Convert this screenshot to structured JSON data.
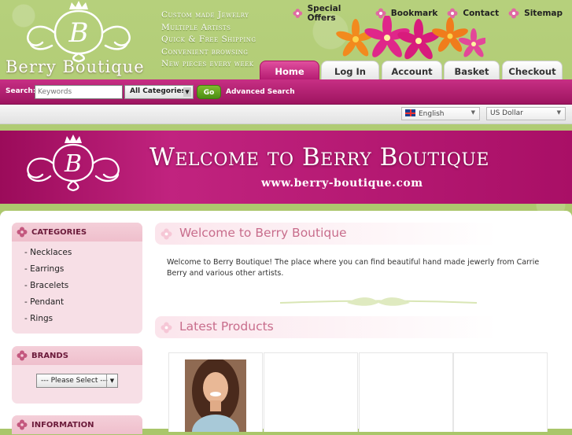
{
  "brand": {
    "name": "Berry Boutique",
    "monogram": "B"
  },
  "taglines": [
    "Custom made Jewelry",
    "Multiple Artists",
    "Quick & Free Shipping",
    "Convenient browsing",
    "New pieces every week"
  ],
  "top_links": [
    {
      "label": "Special Offers",
      "icon": "flower-icon"
    },
    {
      "label": "Bookmark",
      "icon": "flower-icon"
    },
    {
      "label": "Contact",
      "icon": "flower-icon"
    },
    {
      "label": "Sitemap",
      "icon": "flower-icon"
    }
  ],
  "tabs": [
    {
      "label": "Home",
      "active": true
    },
    {
      "label": "Log In",
      "active": false
    },
    {
      "label": "Account",
      "active": false
    },
    {
      "label": "Basket",
      "active": false
    },
    {
      "label": "Checkout",
      "active": false
    }
  ],
  "search": {
    "label": "Search:",
    "placeholder": "Keywords",
    "category_selected": "All Categories",
    "go_label": "Go",
    "advanced_label": "Advanced Search"
  },
  "language": {
    "selected": "English"
  },
  "currency": {
    "selected": "US Dollar"
  },
  "banner": {
    "title": "Welcome to Berry Boutique",
    "url": "www.berry-boutique.com"
  },
  "sidebar": {
    "categories": {
      "title": "CATEGORIES",
      "items": [
        "- Necklaces",
        "- Earrings",
        "- Bracelets",
        "- Pendant",
        "- Rings"
      ]
    },
    "brands": {
      "title": "BRANDS",
      "selected": "--- Please Select ---"
    },
    "information": {
      "title": "INFORMATION"
    }
  },
  "main": {
    "welcome_heading": "Welcome to Berry Boutique",
    "welcome_text": "Welcome to Berry Boutique! The place where you can find beautiful hand made jewerly from Carrie Berry and various other artists.",
    "latest_heading": "Latest Products"
  },
  "colors": {
    "accent": "#b51c72",
    "green": "#a9c66a",
    "pink_light": "#f7dfe6",
    "heading_pink": "#c86d8c"
  }
}
